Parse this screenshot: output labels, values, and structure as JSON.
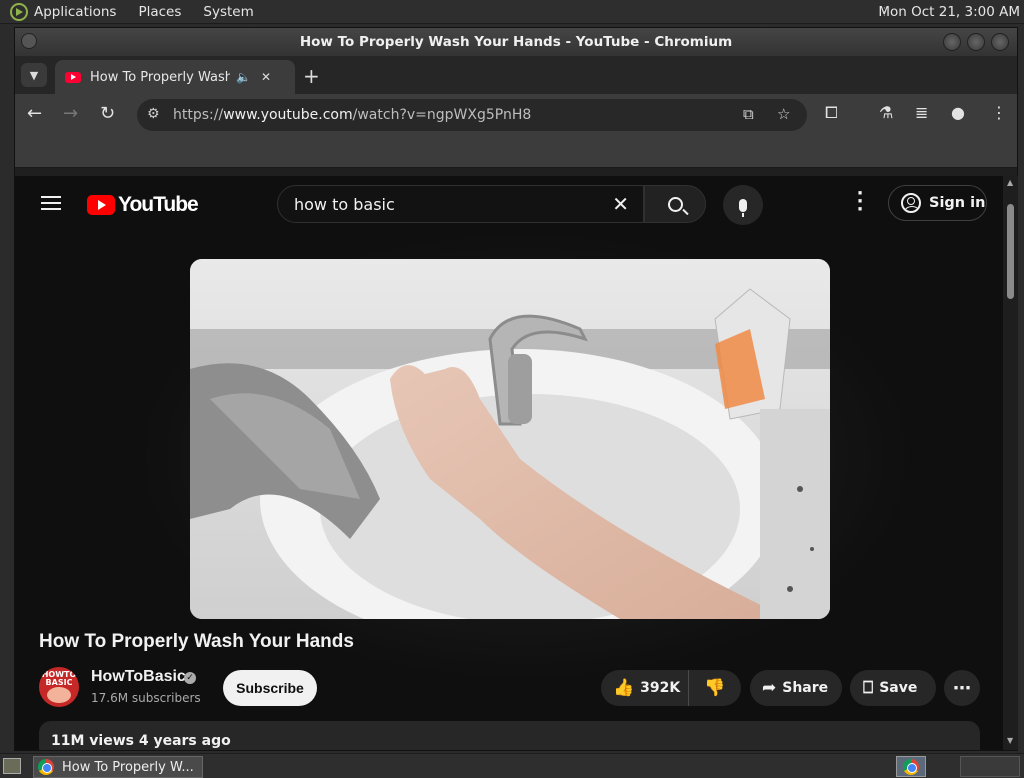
{
  "top_panel": {
    "menus": [
      "Applications",
      "Places",
      "System"
    ],
    "clock": "Mon Oct 21,  3:00 AM"
  },
  "window": {
    "title": "How To Properly Wash Your Hands - YouTube - Chromium"
  },
  "tab": {
    "title": "How To Properly Wash Your Hands - YouTube",
    "audio_icon": "speaker-icon"
  },
  "address_bar": {
    "scheme": "https://",
    "host": "www.youtube.com",
    "path": "/watch?v=ngpWXg5PnH8"
  },
  "youtube": {
    "logo_text": "YouTube",
    "search_value": "how to basic",
    "sign_in_label": "Sign in",
    "video": {
      "title": "How To Properly Wash Your Hands",
      "channel": "HowToBasic",
      "subscribers": "17.6M subscribers",
      "subscribe_label": "Subscribe",
      "avatar_text": "HOWTO BASIC",
      "likes": "392K",
      "share_label": "Share",
      "save_label": "Save",
      "description_preview": "11M views  4 years ago"
    }
  },
  "taskbar": {
    "task_label": "How To Properly W..."
  },
  "colors": {
    "yt_red": "#ff0000",
    "page_bg": "#0f0f0f",
    "chip_bg": "#272727"
  }
}
